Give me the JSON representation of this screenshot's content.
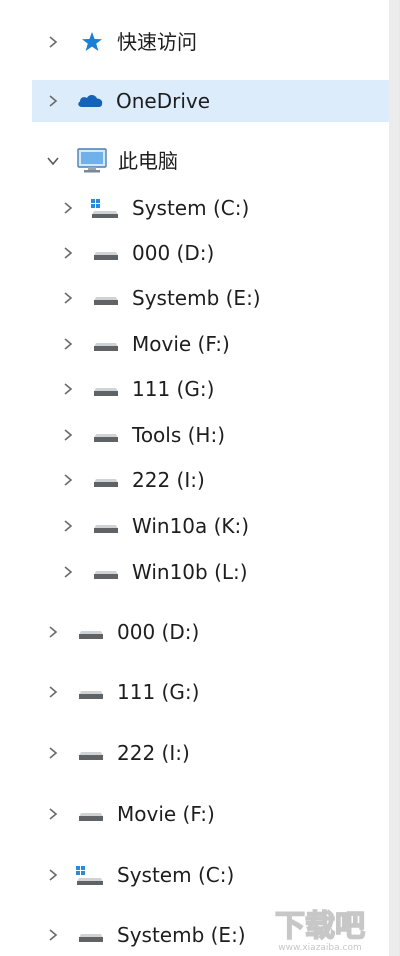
{
  "nav": {
    "quick_access": "快速访问",
    "onedrive": "OneDrive",
    "this_pc": "此电脑",
    "pc_drives": [
      {
        "label": "System (C:)",
        "icon": "system-drive-icon"
      },
      {
        "label": "000 (D:)",
        "icon": "drive-icon"
      },
      {
        "label": "Systemb (E:)",
        "icon": "drive-icon"
      },
      {
        "label": "Movie (F:)",
        "icon": "drive-icon"
      },
      {
        "label": "111 (G:)",
        "icon": "drive-icon"
      },
      {
        "label": "Tools (H:)",
        "icon": "drive-icon"
      },
      {
        "label": "222 (I:)",
        "icon": "drive-icon"
      },
      {
        "label": "Win10a (K:)",
        "icon": "drive-icon"
      },
      {
        "label": "Win10b (L:)",
        "icon": "drive-icon"
      }
    ],
    "top_drives": [
      {
        "label": "000 (D:)",
        "icon": "drive-icon"
      },
      {
        "label": "111 (G:)",
        "icon": "drive-icon"
      },
      {
        "label": "222 (I:)",
        "icon": "drive-icon"
      },
      {
        "label": "Movie (F:)",
        "icon": "drive-icon"
      },
      {
        "label": "System (C:)",
        "icon": "system-drive-icon"
      },
      {
        "label": "Systemb (E:)",
        "icon": "drive-icon"
      }
    ]
  },
  "watermark": {
    "text": "下载吧",
    "url": "www.xiazaiba.com"
  },
  "colors": {
    "selected_bg": "#dcecfb",
    "star": "#1a7fd6",
    "onedrive": "#1563b8",
    "chevron": "#6b6b6b"
  }
}
